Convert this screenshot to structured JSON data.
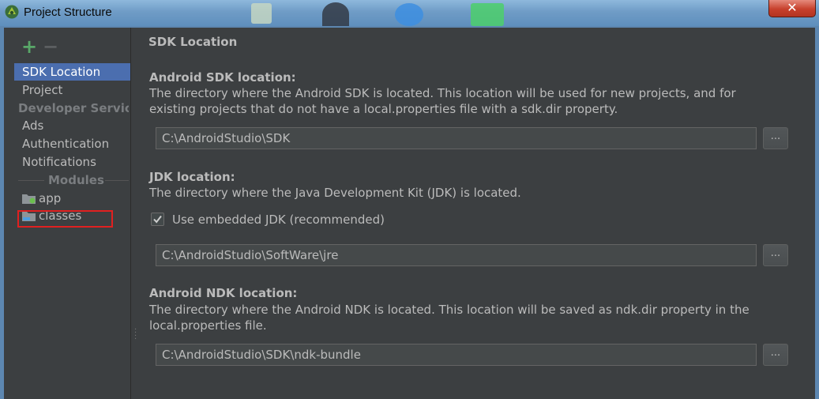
{
  "window": {
    "title": "Project Structure",
    "close_label": "✕"
  },
  "sidebar": {
    "add_label": "+",
    "remove_label": "−",
    "items": [
      {
        "label": "SDK Location",
        "selected": true
      },
      {
        "label": "Project",
        "selected": false
      }
    ],
    "developer_services_group": "Developer Servic...",
    "services": [
      {
        "label": "Ads"
      },
      {
        "label": "Authentication"
      },
      {
        "label": "Notifications"
      }
    ],
    "modules_header": "Modules",
    "modules": [
      {
        "label": "app",
        "icon": "module-folder-icon"
      },
      {
        "label": "classes",
        "icon": "library-folder-icon"
      }
    ]
  },
  "main": {
    "section_title": "SDK Location",
    "android_sdk": {
      "label": "Android SDK location:",
      "description": "The directory where the Android SDK is located. This location will be used for new projects, and for existing projects that do not have a local.properties file with a sdk.dir property.",
      "value": "C:\\AndroidStudio\\SDK",
      "browse_label": "..."
    },
    "jdk": {
      "label": "JDK location:",
      "description": "The directory where the Java Development Kit (JDK) is located.",
      "embedded_checkbox_label": "Use embedded JDK (recommended)",
      "embedded_checked": true,
      "value": "C:\\AndroidStudio\\SoftWare\\jre",
      "browse_label": "..."
    },
    "android_ndk": {
      "label": "Android NDK location:",
      "description": "The directory where the Android NDK is located. This location will be saved as ndk.dir property in the local.properties file.",
      "value": "C:\\AndroidStudio\\SDK\\ndk-bundle",
      "browse_label": "..."
    }
  },
  "colors": {
    "background": "#3c3f41",
    "selection": "#4b6eaf",
    "highlight_box": "#e02020",
    "add_green": "#59a869"
  }
}
